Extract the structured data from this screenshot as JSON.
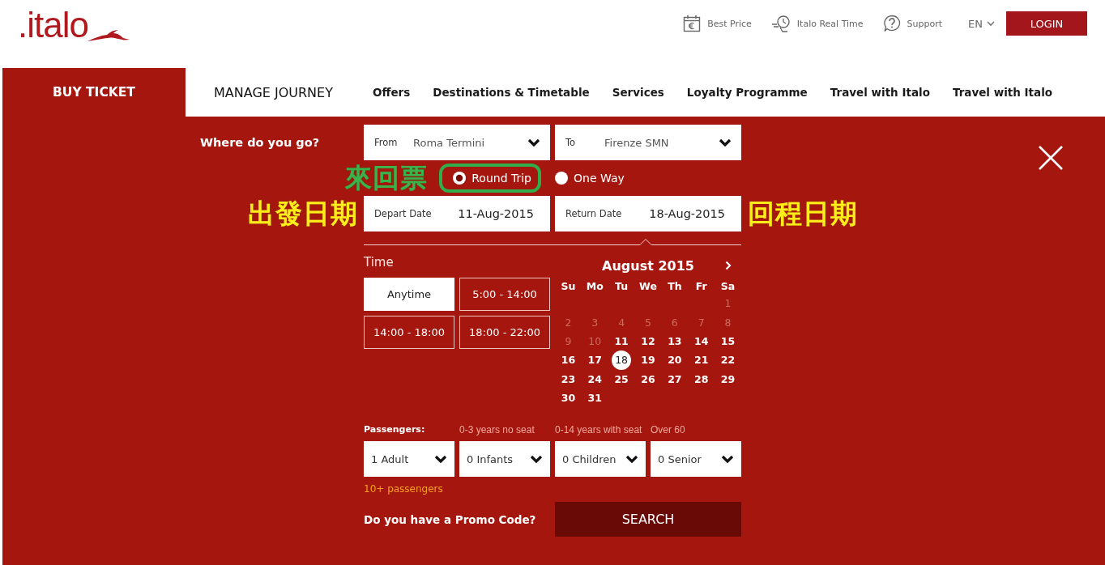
{
  "header": {
    "logo": ".italo",
    "links": [
      {
        "kind": "price",
        "label": "Best Price"
      },
      {
        "kind": "realtime",
        "label": "Italo Real Time"
      },
      {
        "kind": "support",
        "label": "Support"
      }
    ],
    "language": "EN",
    "login": "LOGIN"
  },
  "nav": {
    "tabs": [
      {
        "label": "BUY TICKET",
        "kind": "main",
        "selected": true
      },
      {
        "label": "MANAGE JOURNEY",
        "kind": "main",
        "selected": false
      },
      {
        "label": "Offers",
        "kind": "menu",
        "selected": false
      },
      {
        "label": "Destinations & Timetable",
        "kind": "menu",
        "selected": false
      },
      {
        "label": "Services",
        "kind": "menu",
        "selected": false
      },
      {
        "label": "Loyalty Programme",
        "kind": "menu",
        "selected": false
      },
      {
        "label": "Travel with Italo",
        "kind": "menu",
        "selected": false
      },
      {
        "label": "Travel with Italo",
        "kind": "menu",
        "selected": false
      }
    ]
  },
  "booking": {
    "title": "Where do you go?",
    "from": {
      "label": "From",
      "value": "Roma Termini"
    },
    "to": {
      "label": "To",
      "value": "Firenze SMN"
    },
    "trip": {
      "note": "來回票",
      "options": [
        {
          "label": "Round Trip",
          "selected": true,
          "circled": true
        },
        {
          "label": "One Way",
          "selected": false,
          "circled": false
        }
      ]
    },
    "depart": {
      "note": "出發日期",
      "label": "Depart Date",
      "value": "11-Aug-2015"
    },
    "return": {
      "note": "回程日期",
      "label": "Return Date",
      "value": "18-Aug-2015"
    },
    "time": {
      "title": "Time",
      "options": [
        {
          "label": "Anytime",
          "selected": true
        },
        {
          "label": "5:00 - 14:00",
          "selected": false
        },
        {
          "label": "14:00 - 18:00",
          "selected": false
        },
        {
          "label": "18:00 - 22:00",
          "selected": false
        }
      ]
    },
    "calendar": {
      "month": "August 2015",
      "weekdays": [
        "Su",
        "Mo",
        "Tu",
        "We",
        "Th",
        "Fr",
        "Sa"
      ],
      "weeks": [
        [
          {
            "kind": "blank"
          },
          {
            "kind": "blank"
          },
          {
            "kind": "blank"
          },
          {
            "kind": "blank"
          },
          {
            "kind": "blank"
          },
          {
            "kind": "blank"
          },
          {
            "kind": "day",
            "day": "1",
            "disabled": true,
            "selected": false
          }
        ],
        [
          {
            "kind": "day",
            "day": "2",
            "disabled": true,
            "selected": false
          },
          {
            "kind": "day",
            "day": "3",
            "disabled": true,
            "selected": false
          },
          {
            "kind": "day",
            "day": "4",
            "disabled": true,
            "selected": false
          },
          {
            "kind": "day",
            "day": "5",
            "disabled": true,
            "selected": false
          },
          {
            "kind": "day",
            "day": "6",
            "disabled": true,
            "selected": false
          },
          {
            "kind": "day",
            "day": "7",
            "disabled": true,
            "selected": false
          },
          {
            "kind": "day",
            "day": "8",
            "disabled": true,
            "selected": false
          }
        ],
        [
          {
            "kind": "day",
            "day": "9",
            "disabled": true,
            "selected": false
          },
          {
            "kind": "day",
            "day": "10",
            "disabled": true,
            "selected": false
          },
          {
            "kind": "day",
            "day": "11",
            "disabled": false,
            "selected": false
          },
          {
            "kind": "day",
            "day": "12",
            "disabled": false,
            "selected": false
          },
          {
            "kind": "day",
            "day": "13",
            "disabled": false,
            "selected": false
          },
          {
            "kind": "day",
            "day": "14",
            "disabled": false,
            "selected": false
          },
          {
            "kind": "day",
            "day": "15",
            "disabled": false,
            "selected": false
          }
        ],
        [
          {
            "kind": "day",
            "day": "16",
            "disabled": false,
            "selected": false
          },
          {
            "kind": "day",
            "day": "17",
            "disabled": false,
            "selected": false
          },
          {
            "kind": "day",
            "day": "18",
            "disabled": false,
            "selected": true
          },
          {
            "kind": "day",
            "day": "19",
            "disabled": false,
            "selected": false
          },
          {
            "kind": "day",
            "day": "20",
            "disabled": false,
            "selected": false
          },
          {
            "kind": "day",
            "day": "21",
            "disabled": false,
            "selected": false
          },
          {
            "kind": "day",
            "day": "22",
            "disabled": false,
            "selected": false
          }
        ],
        [
          {
            "kind": "day",
            "day": "23",
            "disabled": false,
            "selected": false
          },
          {
            "kind": "day",
            "day": "24",
            "disabled": false,
            "selected": false
          },
          {
            "kind": "day",
            "day": "25",
            "disabled": false,
            "selected": false
          },
          {
            "kind": "day",
            "day": "26",
            "disabled": false,
            "selected": false
          },
          {
            "kind": "day",
            "day": "27",
            "disabled": false,
            "selected": false
          },
          {
            "kind": "day",
            "day": "28",
            "disabled": false,
            "selected": false
          },
          {
            "kind": "day",
            "day": "29",
            "disabled": false,
            "selected": false
          }
        ],
        [
          {
            "kind": "day",
            "day": "30",
            "disabled": false,
            "selected": false
          },
          {
            "kind": "day",
            "day": "31",
            "disabled": false,
            "selected": false
          }
        ]
      ]
    },
    "passengers": {
      "title": "Passengers:",
      "selects": [
        {
          "value": "1 Adult"
        },
        {
          "hint": "0-3 years no seat",
          "value": "0 Infants"
        },
        {
          "hint": "0-14 years with seat",
          "value": "0 Children"
        },
        {
          "hint": "Over 60",
          "value": "0 Senior"
        }
      ],
      "more": "10+ passengers"
    },
    "promo": "Do you have a Promo Code?",
    "search": "SEARCH"
  }
}
